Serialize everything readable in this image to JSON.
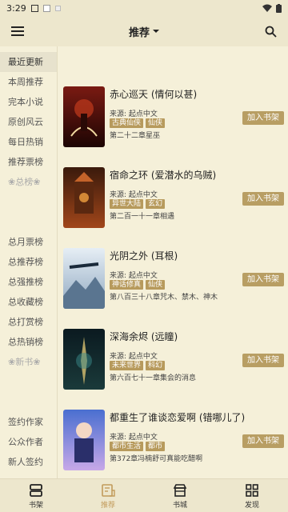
{
  "status": {
    "time": "3:29"
  },
  "header": {
    "title": "推荐"
  },
  "sidebar": {
    "items": [
      {
        "label": "最近更新",
        "active": true
      },
      {
        "label": "本周推荐"
      },
      {
        "label": "完本小说"
      },
      {
        "label": "原创风云"
      },
      {
        "label": "每日热销"
      },
      {
        "label": "推荐票榜"
      },
      {
        "label": "❀总榜❀"
      },
      {
        "label": "总月票榜"
      },
      {
        "label": "总推荐榜"
      },
      {
        "label": "总强推榜"
      },
      {
        "label": "总收藏榜"
      },
      {
        "label": "总打赏榜"
      },
      {
        "label": "总热销榜"
      },
      {
        "label": "❀新书❀"
      },
      {
        "label": "签约作家"
      },
      {
        "label": "公众作者"
      },
      {
        "label": "新人签约"
      }
    ]
  },
  "books": [
    {
      "title": "赤心巡天 (情何以甚)",
      "source": "来源: 起点中文",
      "tags": [
        "古典仙侠",
        "仙侠"
      ],
      "chapter": "第二十二章星巫",
      "action": "加入书架"
    },
    {
      "title": "宿命之环 (爱潜水的乌贼)",
      "source": "来源: 起点中文",
      "tags": [
        "异世大陆",
        "玄幻"
      ],
      "chapter": "第二百一十一章相遇",
      "action": "加入书架"
    },
    {
      "title": "光阴之外 (耳根)",
      "source": "来源: 起点中文",
      "tags": [
        "神话修真",
        "仙侠"
      ],
      "chapter": "第八百三十八章咒木、禁木、神木",
      "action": "加入书架"
    },
    {
      "title": "深海余烬 (远瞳)",
      "source": "来源: 起点中文",
      "tags": [
        "未来世界",
        "科幻"
      ],
      "chapter": "第六百七十一章集会的消息",
      "action": "加入书架"
    },
    {
      "title": "都重生了谁谈恋爱啊 (错哪儿了)",
      "source": "来源: 起点中文",
      "tags": [
        "都市生活",
        "都市"
      ],
      "chapter": "第372章冯楠舒可真能吃醋啊",
      "action": "加入书架"
    }
  ],
  "bottom_nav": [
    {
      "label": "书架",
      "icon": "bookshelf-icon"
    },
    {
      "label": "推荐",
      "icon": "recommend-icon",
      "active": true
    },
    {
      "label": "书城",
      "icon": "store-icon"
    },
    {
      "label": "发现",
      "icon": "discover-icon"
    }
  ],
  "colors": {
    "accent": "#b89e63",
    "background": "#f5f0d9",
    "bar": "#ede7cd"
  }
}
